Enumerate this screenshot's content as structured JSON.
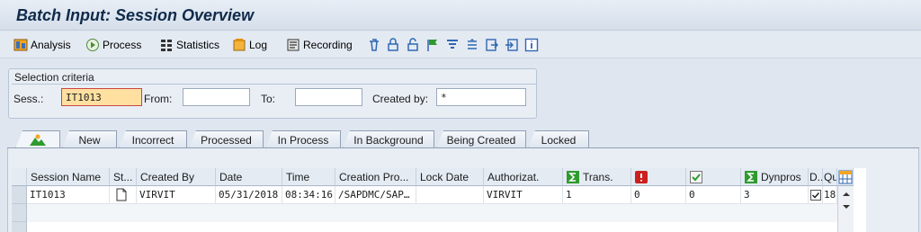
{
  "window": {
    "title": "Batch Input: Session Overview"
  },
  "toolbar": {
    "analysis_label": "Analysis",
    "process_label": "Process",
    "statistics_label": "Statistics",
    "log_label": "Log",
    "recording_label": "Recording",
    "icons": [
      "delete-icon",
      "lock-icon",
      "unlock-icon",
      "flag-icon",
      "filter-icon",
      "sort-icon",
      "export-icon",
      "import-icon",
      "info-icon"
    ]
  },
  "criteria": {
    "title": "Selection criteria",
    "sess_label": "Sess.:",
    "sess_value": "IT1013",
    "from_label": "From:",
    "from_value": "",
    "to_label": "To:",
    "to_value": "",
    "created_by_label": "Created by:",
    "created_by_value": "*"
  },
  "tabs": [
    {
      "label": "",
      "icon": "all-sessions-icon"
    },
    {
      "label": "New"
    },
    {
      "label": "Incorrect"
    },
    {
      "label": "Processed"
    },
    {
      "label": "In Process"
    },
    {
      "label": "In Background"
    },
    {
      "label": "Being Created"
    },
    {
      "label": "Locked"
    }
  ],
  "table": {
    "headers": [
      "Session Name",
      "St...",
      "Created By",
      "Date",
      "Time",
      "Creation Pro...",
      "Lock Date",
      "Authorizat.",
      "Trans.",
      "",
      "",
      "Dynpros",
      "D..",
      "Qu"
    ],
    "rows": [
      {
        "session_name": "IT1013",
        "status_icon": "document-icon",
        "created_by": "VIRVIT",
        "date": "05/31/2018",
        "time": "08:34:16",
        "creation_program": "/SAPDMC/SAP…",
        "lock_date": "",
        "authorization": "VIRVIT",
        "trans": "1",
        "errors": "0",
        "processed": "0",
        "dynpros": "3",
        "d_checked": true,
        "qu": "18"
      }
    ]
  },
  "colors": {
    "accent": "#0f2a4a",
    "error_red": "#cc1f1f",
    "sum_green": "#2f9a2f",
    "highlight": "#ffe0a0"
  }
}
